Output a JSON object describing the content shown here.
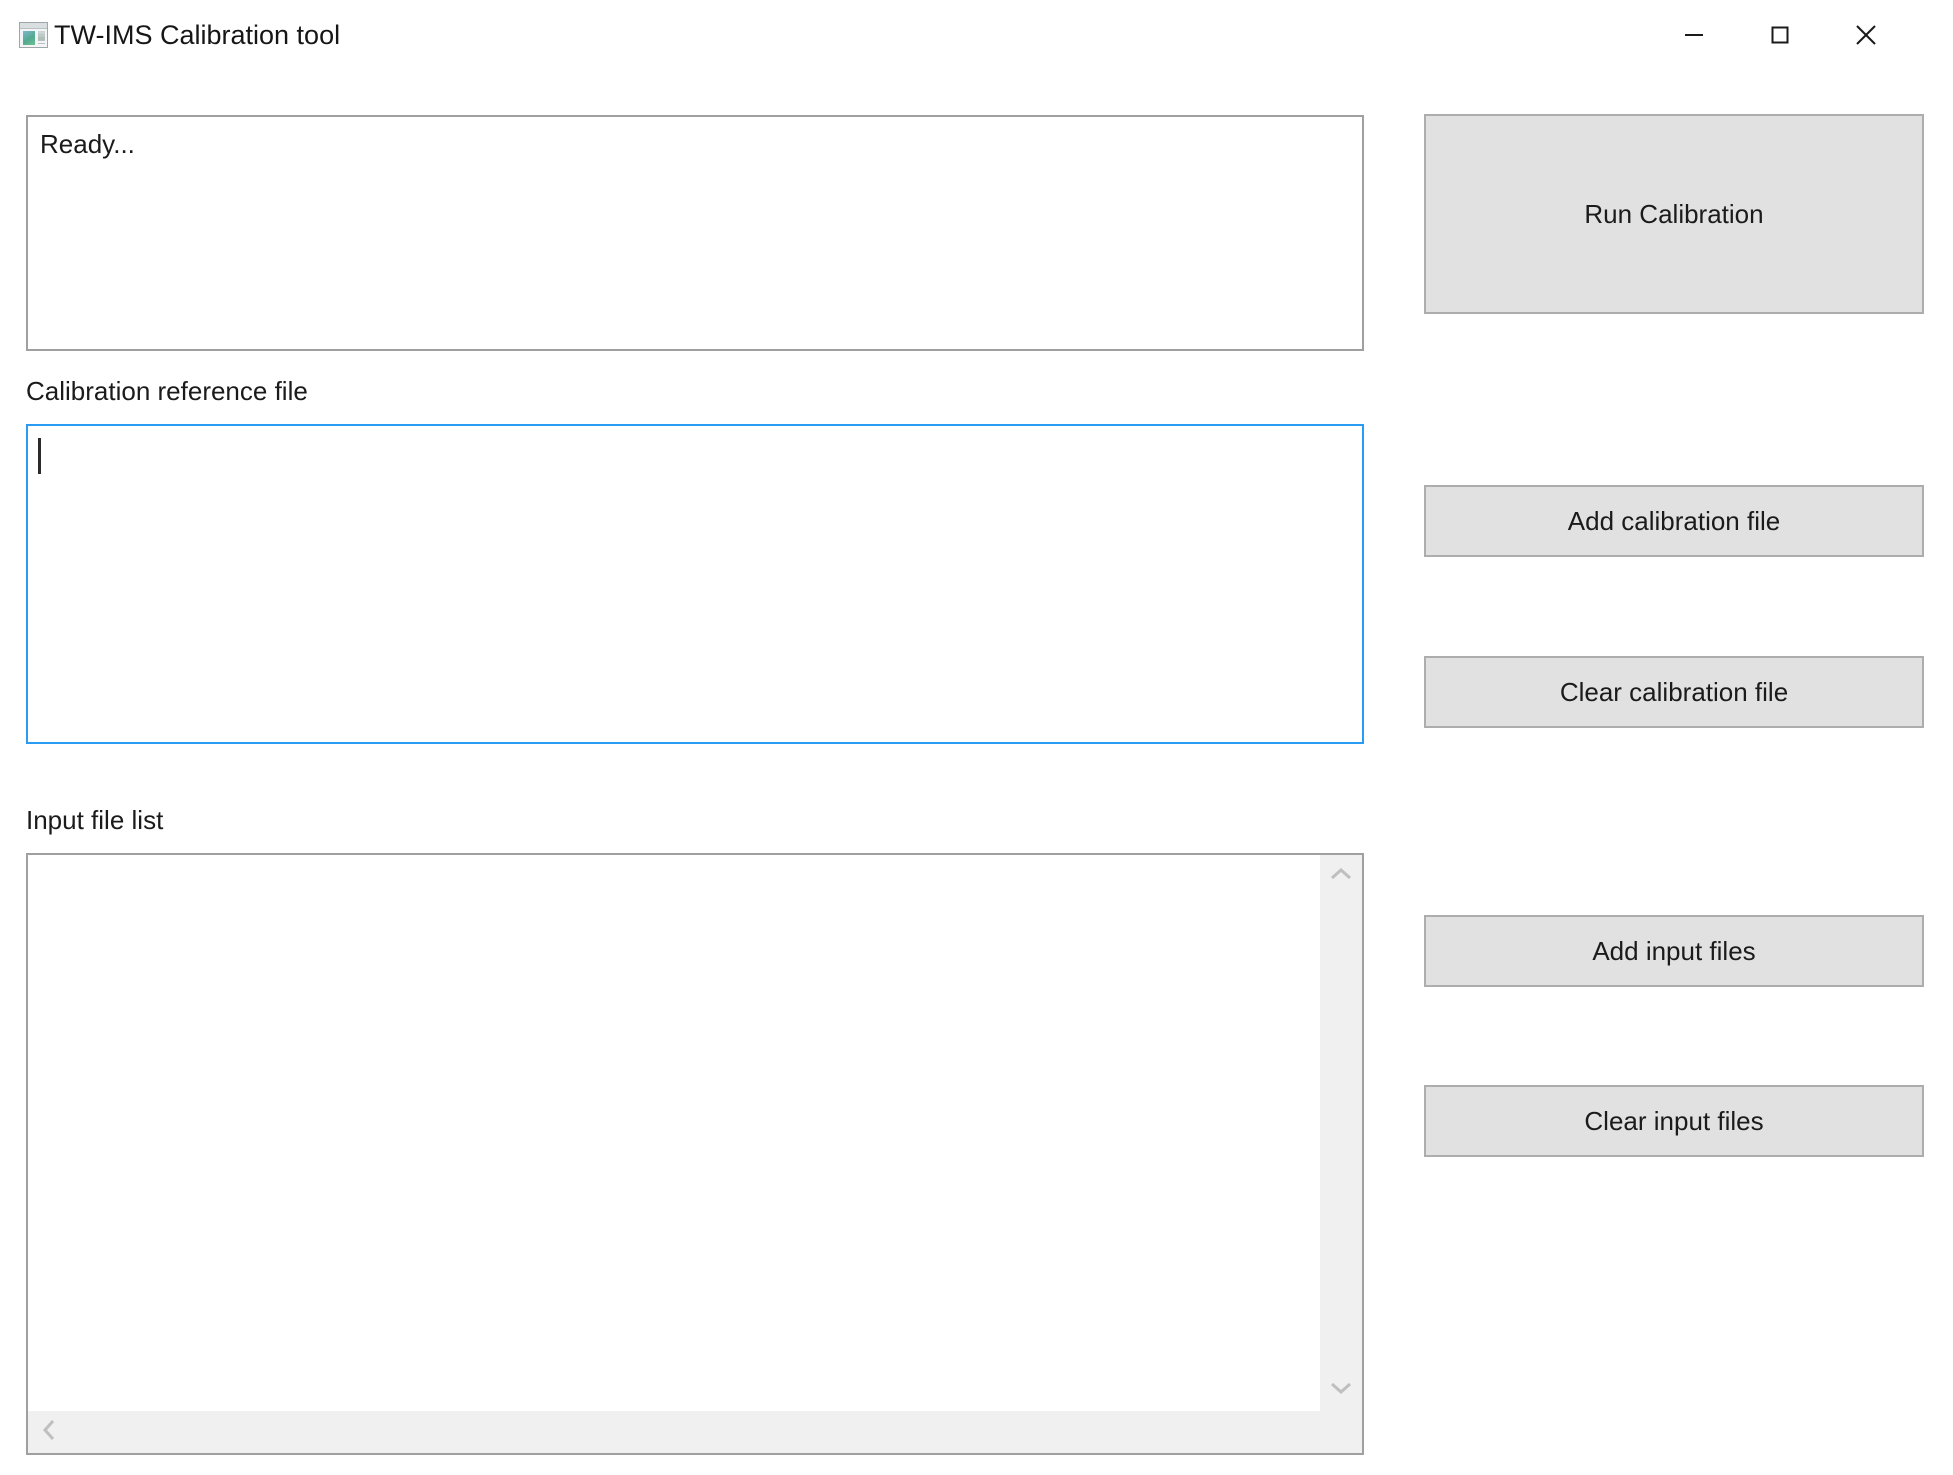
{
  "window": {
    "title": "TW-IMS Calibration tool",
    "icon": "app-window-icon",
    "controls": {
      "minimize": "minimize-icon",
      "maximize": "maximize-icon",
      "close": "close-icon"
    }
  },
  "status": {
    "text": "Ready..."
  },
  "calibration": {
    "label": "Calibration reference file",
    "value": "",
    "focused": true
  },
  "input_list": {
    "label": "Input file list",
    "items": [],
    "scroll": {
      "up": "chevron-up-icon",
      "down": "chevron-down-icon",
      "left": "chevron-left-icon",
      "right": "chevron-right-icon"
    }
  },
  "buttons": {
    "run": "Run Calibration",
    "add_calibration": "Add calibration file",
    "clear_calibration": "Clear calibration file",
    "add_input": "Add input files",
    "clear_input": "Clear input files"
  },
  "colors": {
    "window_bg": "#ffffff",
    "button_face": "#e1e1e1",
    "button_border": "#adadad",
    "box_border": "#a0a0a0",
    "focus_border": "#2a9bf2",
    "scrollbar_track": "#f0f0f0",
    "scrollbar_arrow": "#bfbfbf",
    "text": "#1b1b1b"
  }
}
